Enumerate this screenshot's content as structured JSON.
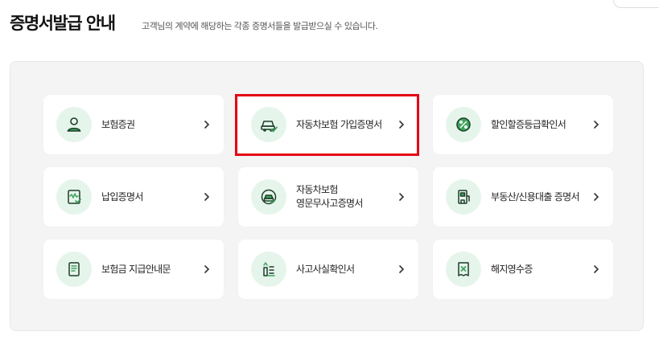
{
  "header": {
    "title": "증명서발급 안내",
    "subtitle": "고객님의 계약에 해당하는 각종 증명서들을 발급받으실 수 있습니다."
  },
  "colors": {
    "accent": "#1a7a3a",
    "icon_bg": "#e6f5eb",
    "highlight": "#e30613"
  },
  "cards": [
    {
      "line1": "보험증권",
      "line2": "",
      "icon": "person-icon",
      "selected": false
    },
    {
      "line1": "자동차보험 가입증명서",
      "line2": "",
      "icon": "car-check-icon",
      "selected": true
    },
    {
      "line1": "할인할증등급확인서",
      "line2": "",
      "icon": "percent-badge-icon",
      "selected": false
    },
    {
      "line1": "납입증명서",
      "line2": "",
      "icon": "receipt-check-icon",
      "selected": false
    },
    {
      "line1": "자동차보험",
      "line2": "영문무사고증명서",
      "icon": "car-globe-icon",
      "selected": false
    },
    {
      "line1": "부동산/신용대출 증명서",
      "line2": "",
      "icon": "building-check-icon",
      "selected": false
    },
    {
      "line1": "보험금 지급안내문",
      "line2": "",
      "icon": "document-icon",
      "selected": false
    },
    {
      "line1": "사고사실확인서",
      "line2": "",
      "icon": "accident-icon",
      "selected": false
    },
    {
      "line1": "해지영수증",
      "line2": "",
      "icon": "cancel-receipt-icon",
      "selected": false
    }
  ]
}
